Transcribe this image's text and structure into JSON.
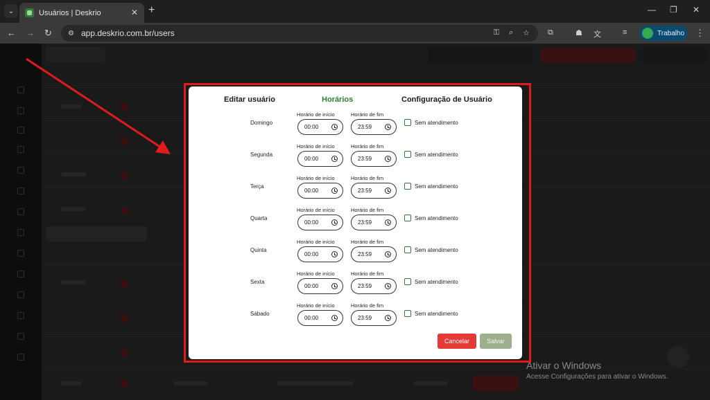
{
  "browser": {
    "tab_title": "Usuários | Deskrio",
    "url": "app.deskrio.com.br/users",
    "profile_label": "Trabalho"
  },
  "modal": {
    "tabs": [
      {
        "label": "Editar usuário",
        "active": false
      },
      {
        "label": "Horários",
        "active": true
      },
      {
        "label": "Configuração de Usuário",
        "active": false
      }
    ],
    "start_label": "Horário de início",
    "end_label": "Horário de fim",
    "no_service_label": "Sem atendimento",
    "days": [
      {
        "name": "Domingo",
        "start": "00:00",
        "end": "23:59",
        "no_service": false
      },
      {
        "name": "Segunda",
        "start": "00:00",
        "end": "23:59",
        "no_service": false
      },
      {
        "name": "Terça",
        "start": "00:00",
        "end": "23:59",
        "no_service": false
      },
      {
        "name": "Quarta",
        "start": "00:00",
        "end": "23:59",
        "no_service": false
      },
      {
        "name": "Quinta",
        "start": "00:00",
        "end": "23:59",
        "no_service": false
      },
      {
        "name": "Sexta",
        "start": "00:00",
        "end": "23:59",
        "no_service": false
      },
      {
        "name": "Sábado",
        "start": "00:00",
        "end": "23:59",
        "no_service": false
      }
    ],
    "cancel_label": "Cancelar",
    "save_label": "Salvar"
  },
  "watermark": {
    "title": "Ativar o Windows",
    "subtitle": "Acesse Configurações para ativar o Windows."
  },
  "colors": {
    "accent_green": "#2e7d32",
    "cancel_red": "#e53935",
    "save_green": "#9cb08e",
    "annotation_red": "#e01b1b"
  }
}
